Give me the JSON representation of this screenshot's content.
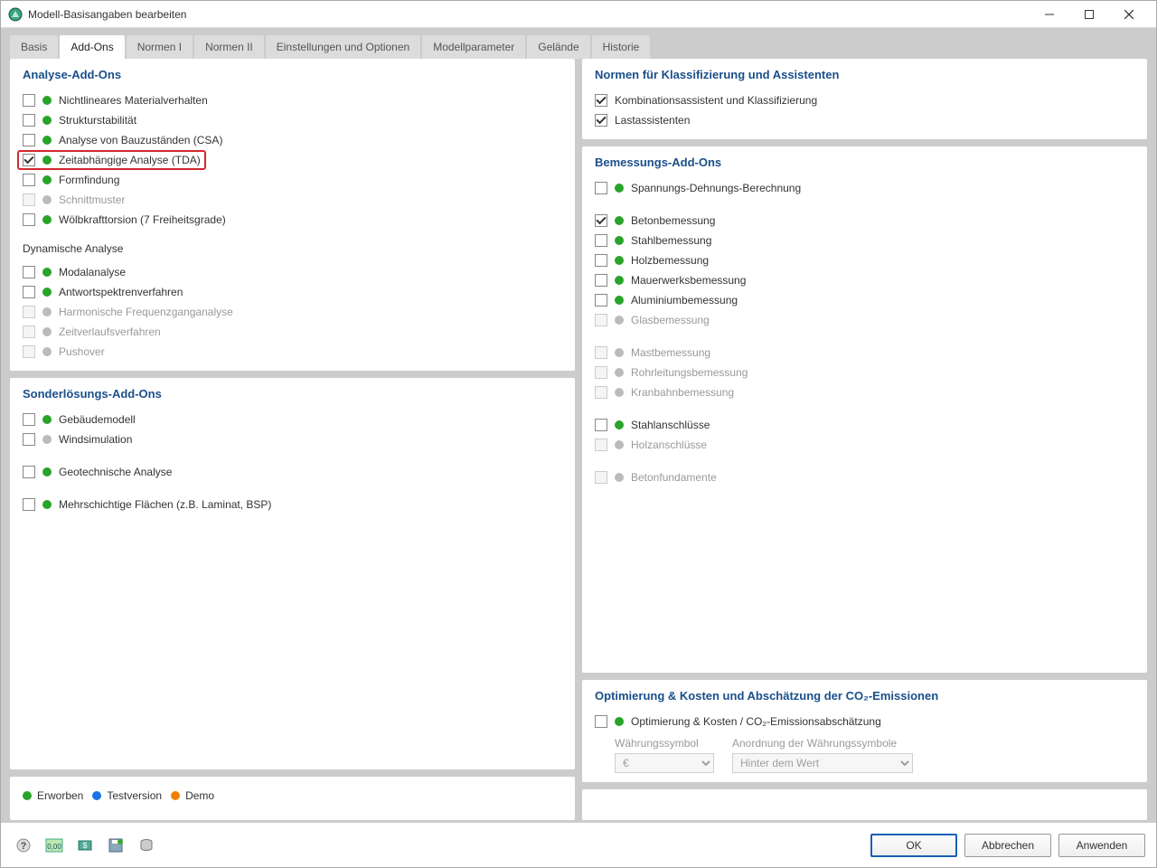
{
  "window": {
    "title": "Modell-Basisangaben bearbeiten"
  },
  "tabs": [
    "Basis",
    "Add-Ons",
    "Normen I",
    "Normen II",
    "Einstellungen und Optionen",
    "Modellparameter",
    "Gelände",
    "Historie"
  ],
  "activeTab": "Add-Ons",
  "left": {
    "analysis": {
      "heading": "Analyse-Add-Ons",
      "items": [
        {
          "label": "Nichtlineares Materialverhalten",
          "checked": false,
          "dot": "green",
          "enabled": true,
          "hl": false
        },
        {
          "label": "Strukturstabilität",
          "checked": false,
          "dot": "green",
          "enabled": true,
          "hl": false
        },
        {
          "label": "Analyse von Bauzuständen (CSA)",
          "checked": false,
          "dot": "green",
          "enabled": true,
          "hl": false
        },
        {
          "label": "Zeitabhängige Analyse (TDA)",
          "checked": true,
          "dot": "green",
          "enabled": true,
          "hl": true
        },
        {
          "label": "Formfindung",
          "checked": false,
          "dot": "green",
          "enabled": true,
          "hl": false
        },
        {
          "label": "Schnittmuster",
          "checked": false,
          "dot": "grey",
          "enabled": false,
          "hl": false
        },
        {
          "label": "Wölbkrafttorsion (7 Freiheitsgrade)",
          "checked": false,
          "dot": "green",
          "enabled": true,
          "hl": false
        }
      ],
      "dyn_heading": "Dynamische Analyse",
      "dyn_items": [
        {
          "label": "Modalanalyse",
          "checked": false,
          "dot": "green",
          "enabled": true
        },
        {
          "label": "Antwortspektrenverfahren",
          "checked": false,
          "dot": "green",
          "enabled": true
        },
        {
          "label": "Harmonische Frequenzganganalyse",
          "checked": false,
          "dot": "grey",
          "enabled": false
        },
        {
          "label": "Zeitverlaufsverfahren",
          "checked": false,
          "dot": "grey",
          "enabled": false
        },
        {
          "label": "Pushover",
          "checked": false,
          "dot": "grey",
          "enabled": false
        }
      ]
    },
    "sonder": {
      "heading": "Sonderlösungs-Add-Ons",
      "items": [
        {
          "label": "Gebäudemodell",
          "checked": false,
          "dot": "green",
          "enabled": true
        },
        {
          "label": "Windsimulation",
          "checked": false,
          "dot": "grey",
          "enabled": true
        }
      ],
      "items2": [
        {
          "label": "Geotechnische Analyse",
          "checked": false,
          "dot": "green",
          "enabled": true
        }
      ],
      "items3": [
        {
          "label": "Mehrschichtige Flächen (z.B. Laminat, BSP)",
          "checked": false,
          "dot": "green",
          "enabled": true
        }
      ]
    },
    "legend": {
      "acquired": "Erworben",
      "trial": "Testversion",
      "demo": "Demo"
    }
  },
  "right": {
    "normen": {
      "heading": "Normen für Klassifizierung und Assistenten",
      "items": [
        {
          "label": "Kombinationsassistent und Klassifizierung",
          "checked": true,
          "enabled": true
        },
        {
          "label": "Lastassistenten",
          "checked": true,
          "enabled": true
        }
      ]
    },
    "bemessung": {
      "heading": "Bemessungs-Add-Ons",
      "g1": [
        {
          "label": "Spannungs-Dehnungs-Berechnung",
          "checked": false,
          "dot": "green",
          "enabled": true
        }
      ],
      "g2": [
        {
          "label": "Betonbemessung",
          "checked": true,
          "dot": "green",
          "enabled": true
        },
        {
          "label": "Stahlbemessung",
          "checked": false,
          "dot": "green",
          "enabled": true
        },
        {
          "label": "Holzbemessung",
          "checked": false,
          "dot": "green",
          "enabled": true
        },
        {
          "label": "Mauerwerksbemessung",
          "checked": false,
          "dot": "green",
          "enabled": true
        },
        {
          "label": "Aluminiumbemessung",
          "checked": false,
          "dot": "green",
          "enabled": true
        },
        {
          "label": "Glasbemessung",
          "checked": false,
          "dot": "grey",
          "enabled": false
        }
      ],
      "g3": [
        {
          "label": "Mastbemessung",
          "checked": false,
          "dot": "grey",
          "enabled": false
        },
        {
          "label": "Rohrleitungsbemessung",
          "checked": false,
          "dot": "grey",
          "enabled": false
        },
        {
          "label": "Kranbahnbemessung",
          "checked": false,
          "dot": "grey",
          "enabled": false
        }
      ],
      "g4": [
        {
          "label": "Stahlanschlüsse",
          "checked": false,
          "dot": "green",
          "enabled": true
        },
        {
          "label": "Holzanschlüsse",
          "checked": false,
          "dot": "grey",
          "enabled": false
        }
      ],
      "g5": [
        {
          "label": "Betonfundamente",
          "checked": false,
          "dot": "grey",
          "enabled": false
        }
      ]
    },
    "opt": {
      "heading": "Optimierung & Kosten und Abschätzung der CO₂-Emissionen",
      "item": {
        "label": "Optimierung & Kosten / CO₂-Emissionsabschätzung",
        "checked": false,
        "dot": "green",
        "enabled": true
      },
      "currency_label": "Währungssymbol",
      "currency_value": "€",
      "arrange_label": "Anordnung der Währungssymbole",
      "arrange_value": "Hinter dem Wert"
    }
  },
  "footer": {
    "ok": "OK",
    "cancel": "Abbrechen",
    "apply": "Anwenden"
  }
}
